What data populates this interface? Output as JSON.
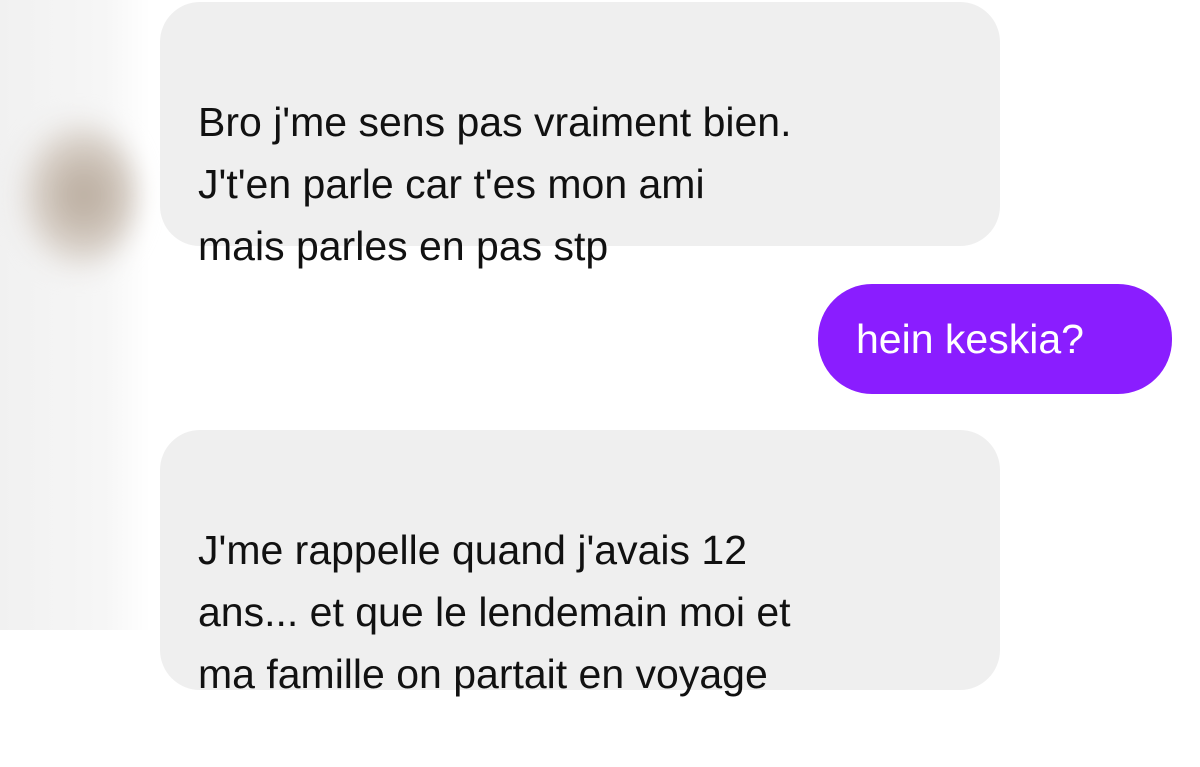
{
  "conversation": {
    "messages": [
      {
        "direction": "incoming",
        "text": "Bro j'me sens pas vraiment bien.\nJ't'en parle car t'es mon ami\nmais parles en pas stp"
      },
      {
        "direction": "outgoing",
        "text": "hein keskia?"
      },
      {
        "direction": "incoming",
        "text": "J'me rappelle quand j'avais 12\nans... et que le lendemain moi et\nma famille on partait en voyage"
      }
    ]
  },
  "colors": {
    "incoming_bubble": "#efefef",
    "outgoing_bubble": "#8a1dff",
    "incoming_text": "#111111",
    "outgoing_text": "#ffffff"
  }
}
